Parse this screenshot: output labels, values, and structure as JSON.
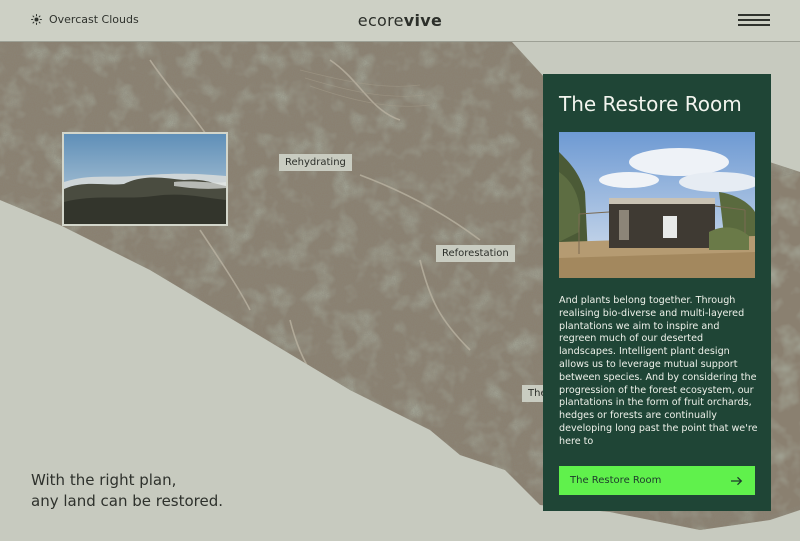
{
  "header": {
    "weather_text": "Overcast Clouds",
    "weather_icon": "sun-icon",
    "logo_light": "ecore",
    "logo_bold": "vive",
    "menu_icon": "hamburger-menu-icon"
  },
  "map": {
    "labels": [
      "Rehydrating",
      "Reforestation",
      "The"
    ]
  },
  "tagline": {
    "line1": "With the right plan,",
    "line2": "any land can be restored."
  },
  "panel": {
    "title": "The Restore Room",
    "body": "And plants belong together. Through realising bio-diverse and multi-layered plantations we aim to inspire and regreen much of our deserted landscapes. Intelligent plant design allows us to leverage mutual support between species. And by considering the progression of the forest ecosystem, our plantations in the form of fruit orchards, hedges or forests are continually developing long past the point that we're here to",
    "button_label": "The Restore Room",
    "button_icon": "arrow-right-icon"
  },
  "colors": {
    "panel_bg": "#1f4536",
    "button_bg": "#60f14c",
    "page_bg": "#c7cabf"
  }
}
